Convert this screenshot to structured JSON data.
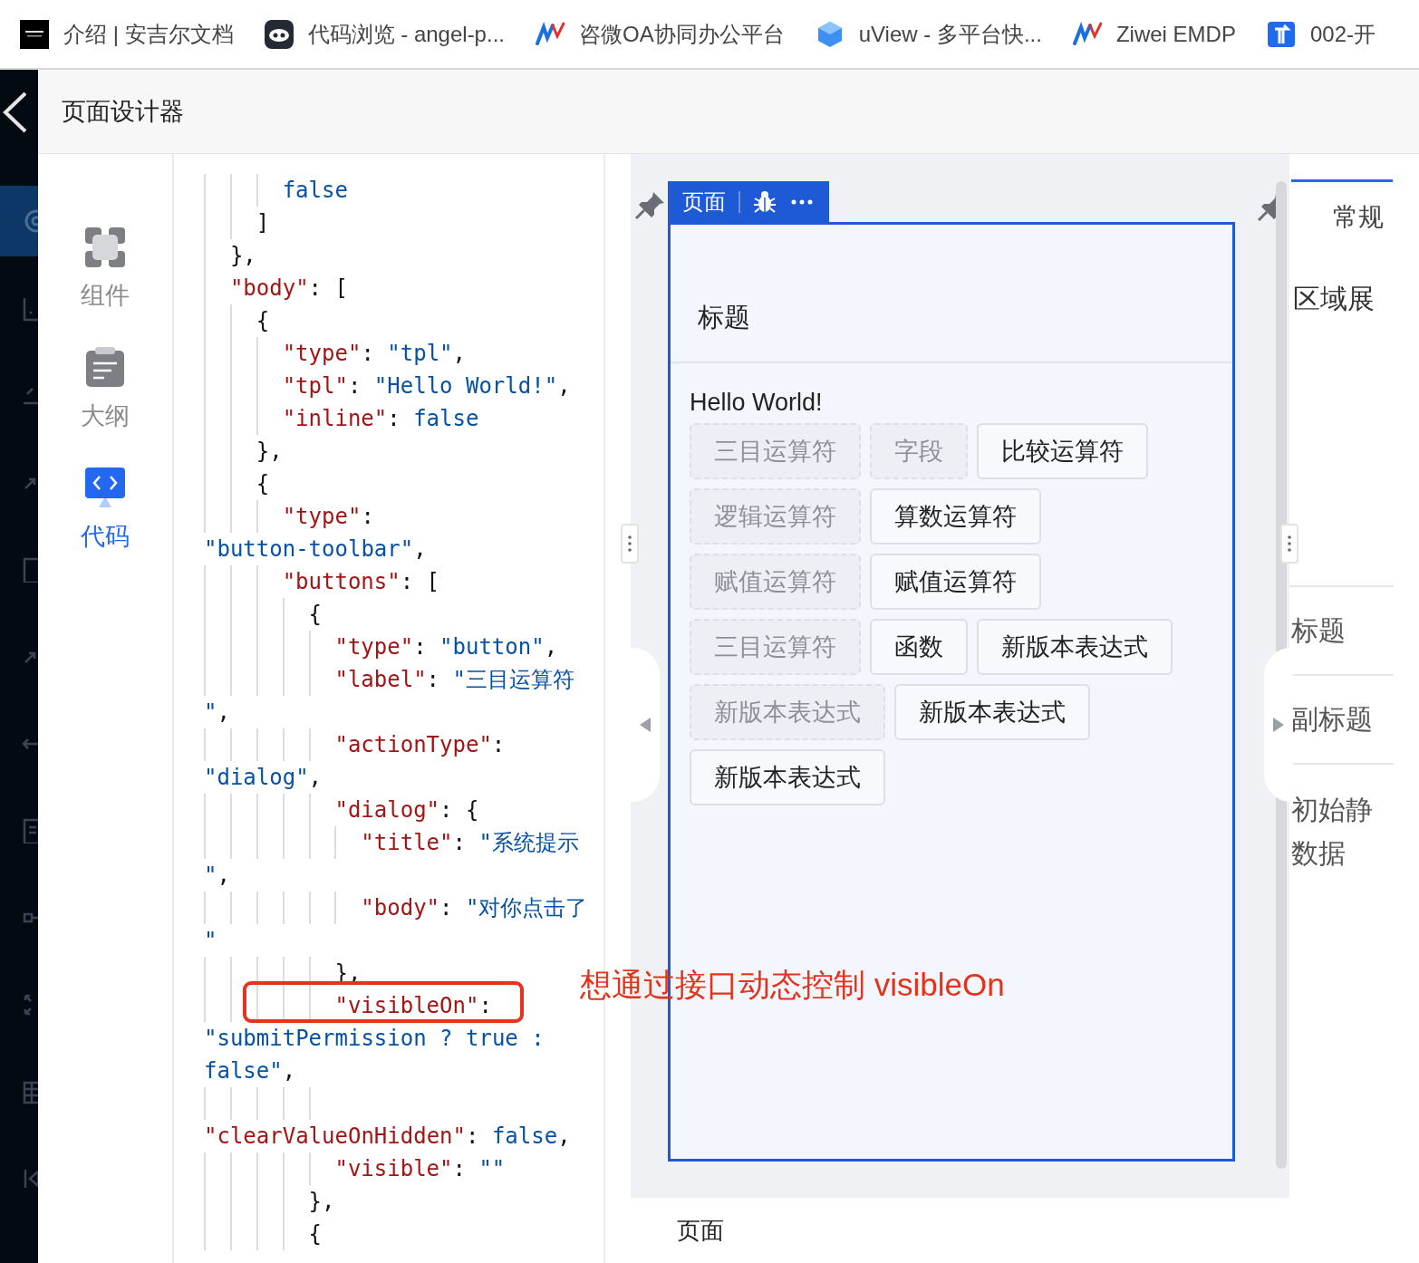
{
  "bookmarks": [
    {
      "kind": "square",
      "label": "介绍 | 安吉尔文档"
    },
    {
      "kind": "face",
      "label": "代码浏览 - angel-p..."
    },
    {
      "kind": "wave",
      "label": "咨微OA协同办公平台"
    },
    {
      "kind": "cube",
      "label": "uView - 多平台快..."
    },
    {
      "kind": "wave",
      "label": "Ziwei EMDP"
    },
    {
      "kind": "sign",
      "label": "002-开"
    }
  ],
  "header": {
    "title": "页面设计器"
  },
  "nav": [
    {
      "kind": "grid",
      "label": "组件",
      "selected": false
    },
    {
      "kind": "document",
      "label": "大纲",
      "selected": false
    },
    {
      "kind": "code",
      "label": "代码",
      "selected": true
    }
  ],
  "code": {
    "lines": [
      {
        "boxed": false,
        "segments": [
          {
            "kind": "lit",
            "text": "      false"
          }
        ]
      },
      {
        "boxed": false,
        "segments": [
          {
            "kind": "p",
            "text": "    ]"
          }
        ]
      },
      {
        "boxed": false,
        "segments": [
          {
            "kind": "p",
            "text": "  },"
          }
        ]
      },
      {
        "boxed": false,
        "segments": [
          {
            "kind": "key",
            "text": "  \"body\""
          },
          {
            "kind": "p",
            "text": ": ["
          }
        ]
      },
      {
        "boxed": false,
        "segments": [
          {
            "kind": "p",
            "text": "    {"
          }
        ]
      },
      {
        "boxed": false,
        "segments": [
          {
            "kind": "key",
            "text": "      \"type\""
          },
          {
            "kind": "p",
            "text": ": "
          },
          {
            "kind": "str",
            "text": "\"tpl\""
          },
          {
            "kind": "p",
            "text": ","
          }
        ]
      },
      {
        "boxed": false,
        "segments": [
          {
            "kind": "key",
            "text": "      \"tpl\""
          },
          {
            "kind": "p",
            "text": ": "
          },
          {
            "kind": "str",
            "text": "\"Hello World!\""
          },
          {
            "kind": "p",
            "text": ","
          }
        ]
      },
      {
        "boxed": false,
        "segments": [
          {
            "kind": "key",
            "text": "      \"inline\""
          },
          {
            "kind": "p",
            "text": ": "
          },
          {
            "kind": "lit",
            "text": "false"
          }
        ]
      },
      {
        "boxed": false,
        "segments": [
          {
            "kind": "p",
            "text": "    },"
          }
        ]
      },
      {
        "boxed": false,
        "segments": [
          {
            "kind": "p",
            "text": "    {"
          }
        ]
      },
      {
        "boxed": false,
        "segments": [
          {
            "kind": "key",
            "text": "      \"type\""
          },
          {
            "kind": "p",
            "text": ":"
          }
        ]
      },
      {
        "boxed": false,
        "segments": [
          {
            "kind": "str",
            "text": "\"button-toolbar\""
          },
          {
            "kind": "p",
            "text": ","
          }
        ]
      },
      {
        "boxed": false,
        "segments": [
          {
            "kind": "key",
            "text": "      \"buttons\""
          },
          {
            "kind": "p",
            "text": ": ["
          }
        ]
      },
      {
        "boxed": false,
        "segments": [
          {
            "kind": "p",
            "text": "        {"
          }
        ]
      },
      {
        "boxed": false,
        "segments": [
          {
            "kind": "key",
            "text": "          \"type\""
          },
          {
            "kind": "p",
            "text": ": "
          },
          {
            "kind": "str",
            "text": "\"button\""
          },
          {
            "kind": "p",
            "text": ","
          }
        ]
      },
      {
        "boxed": false,
        "segments": [
          {
            "kind": "key",
            "text": "          \"label\""
          },
          {
            "kind": "p",
            "text": ": "
          },
          {
            "kind": "str",
            "text": "\"三目运算符"
          }
        ]
      },
      {
        "boxed": false,
        "segments": [
          {
            "kind": "str",
            "text": "\""
          },
          {
            "kind": "p",
            "text": ","
          }
        ]
      },
      {
        "boxed": false,
        "segments": [
          {
            "kind": "key",
            "text": "          \"actionType\""
          },
          {
            "kind": "p",
            "text": ":"
          }
        ]
      },
      {
        "boxed": false,
        "segments": [
          {
            "kind": "str",
            "text": "\"dialog\""
          },
          {
            "kind": "p",
            "text": ","
          }
        ]
      },
      {
        "boxed": false,
        "segments": [
          {
            "kind": "key",
            "text": "          \"dialog\""
          },
          {
            "kind": "p",
            "text": ": {"
          }
        ]
      },
      {
        "boxed": false,
        "segments": [
          {
            "kind": "key",
            "text": "            \"title\""
          },
          {
            "kind": "p",
            "text": ": "
          },
          {
            "kind": "str",
            "text": "\"系统提示"
          }
        ]
      },
      {
        "boxed": false,
        "segments": [
          {
            "kind": "str",
            "text": "\""
          },
          {
            "kind": "p",
            "text": ","
          }
        ]
      },
      {
        "boxed": false,
        "segments": [
          {
            "kind": "key",
            "text": "            \"body\""
          },
          {
            "kind": "p",
            "text": ": "
          },
          {
            "kind": "str",
            "text": "\"对你点击了"
          }
        ]
      },
      {
        "boxed": false,
        "segments": [
          {
            "kind": "str",
            "text": "\""
          }
        ]
      },
      {
        "boxed": false,
        "segments": [
          {
            "kind": "p",
            "text": "          },"
          }
        ]
      },
      {
        "boxed": true,
        "segments": [
          {
            "kind": "key",
            "text": "          \"visibleOn\""
          },
          {
            "kind": "p",
            "text": ":"
          }
        ]
      },
      {
        "boxed": false,
        "segments": [
          {
            "kind": "str",
            "text": "\"submitPermission ? true :"
          }
        ]
      },
      {
        "boxed": false,
        "segments": [
          {
            "kind": "str",
            "text": "false\""
          },
          {
            "kind": "p",
            "text": ","
          }
        ]
      },
      {
        "boxed": false,
        "segments": [
          {
            "kind": "key",
            "text": "          \"clearValueOnHidden\""
          },
          {
            "kind": "p",
            "text": ": "
          },
          {
            "kind": "lit",
            "text": "false"
          },
          {
            "kind": "p",
            "text": ","
          }
        ]
      },
      {
        "boxed": false,
        "segments": [
          {
            "kind": "key",
            "text": "          \"visible\""
          },
          {
            "kind": "p",
            "text": ": "
          },
          {
            "kind": "str",
            "text": "\"\""
          }
        ]
      },
      {
        "boxed": false,
        "segments": [
          {
            "kind": "p",
            "text": "        },"
          }
        ]
      },
      {
        "boxed": false,
        "segments": [
          {
            "kind": "p",
            "text": "        {"
          }
        ]
      }
    ]
  },
  "preview": {
    "tab": "页面",
    "page_title": "标题",
    "tpl": "Hello World!",
    "button_rows": [
      [
        {
          "label": "三目运算符",
          "hidden": true
        },
        {
          "label": "字段",
          "hidden": true
        },
        {
          "label": "比较运算符",
          "hidden": false
        }
      ],
      [
        {
          "label": "逻辑运算符",
          "hidden": true
        },
        {
          "label": "算数运算符",
          "hidden": false
        }
      ],
      [
        {
          "label": "赋值运算符",
          "hidden": true
        },
        {
          "label": "赋值运算符",
          "hidden": false
        }
      ],
      [
        {
          "label": "三目运算符",
          "hidden": true
        },
        {
          "label": "函数",
          "hidden": false
        },
        {
          "label": "新版本表达式",
          "hidden": false
        }
      ],
      [
        {
          "label": "新版本表达式",
          "hidden": true
        },
        {
          "label": "新版本表达式",
          "hidden": false
        }
      ],
      [
        {
          "label": "新版本表达式",
          "hidden": false
        }
      ]
    ],
    "footer": "页面"
  },
  "annotation": "想通过接口动态控制 visibleOn",
  "props": {
    "tabs": [
      {
        "label": "常规",
        "selected": true
      }
    ],
    "section": "区域展",
    "fields": [
      {
        "lines": [
          "标题"
        ]
      },
      {
        "lines": [
          "副标题"
        ]
      },
      {
        "lines": [
          "初始静",
          "数据"
        ]
      }
    ]
  }
}
